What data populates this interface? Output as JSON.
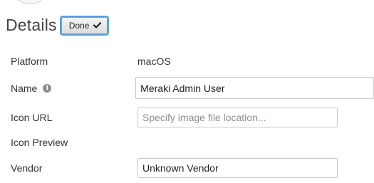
{
  "header": {
    "title": "Details",
    "done_label": "Done"
  },
  "form": {
    "platform_label": "Platform",
    "platform_value": "macOS",
    "name_label": "Name",
    "name_value": "Meraki Admin User",
    "icon_url_label": "Icon URL",
    "icon_url_placeholder": "Specify image file location...",
    "icon_preview_label": "Icon Preview",
    "vendor_label": "Vendor",
    "vendor_value": "Unknown Vendor"
  },
  "icons": {
    "done": "check-icon",
    "name_help": "info-icon"
  }
}
